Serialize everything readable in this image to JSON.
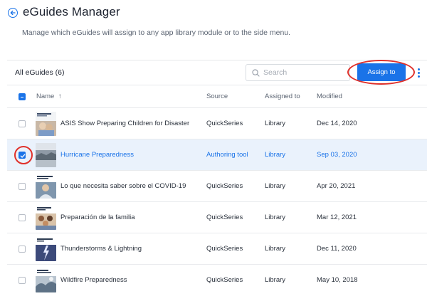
{
  "header": {
    "title": "eGuides Manager",
    "subtitle": "Manage which eGuides will assign to any app library module or to the side menu."
  },
  "toolbar": {
    "all_label": "All eGuides (6)",
    "search_placeholder": "Search",
    "assign_label": "Assign to"
  },
  "table": {
    "columns": {
      "name": "Name",
      "sort": "↑",
      "source": "Source",
      "assigned": "Assigned to",
      "modified": "Modified"
    },
    "rows": [
      {
        "name": "ASIS Show Preparing Children for Disaster",
        "source": "QuickSeries",
        "assigned": "Library",
        "modified": "Dec 14, 2020",
        "selected": false
      },
      {
        "name": "Hurricane Preparedness",
        "source": "Authoring tool",
        "assigned": "Library",
        "modified": "Sep 03, 2020",
        "selected": true
      },
      {
        "name": "Lo que necesita saber sobre el COVID-19",
        "source": "QuickSeries",
        "assigned": "Library",
        "modified": "Apr 20, 2021",
        "selected": false
      },
      {
        "name": "Preparación de la familia",
        "source": "QuickSeries",
        "assigned": "Library",
        "modified": "Mar 12, 2021",
        "selected": false
      },
      {
        "name": "Thunderstorms & Lightning",
        "source": "QuickSeries",
        "assigned": "Library",
        "modified": "Dec 11, 2020",
        "selected": false
      },
      {
        "name": "Wildfire Preparedness",
        "source": "QuickSeries",
        "assigned": "Library",
        "modified": "May 10, 2018",
        "selected": false
      }
    ]
  },
  "icons": {
    "back": "arrow-left-circle-icon",
    "search": "search-icon",
    "more": "more-vertical-icon",
    "sort": "arrow-up-icon"
  },
  "colors": {
    "accent": "#1a73e8",
    "annotation": "#e0302a",
    "selected_row": "#eaf2fc"
  }
}
